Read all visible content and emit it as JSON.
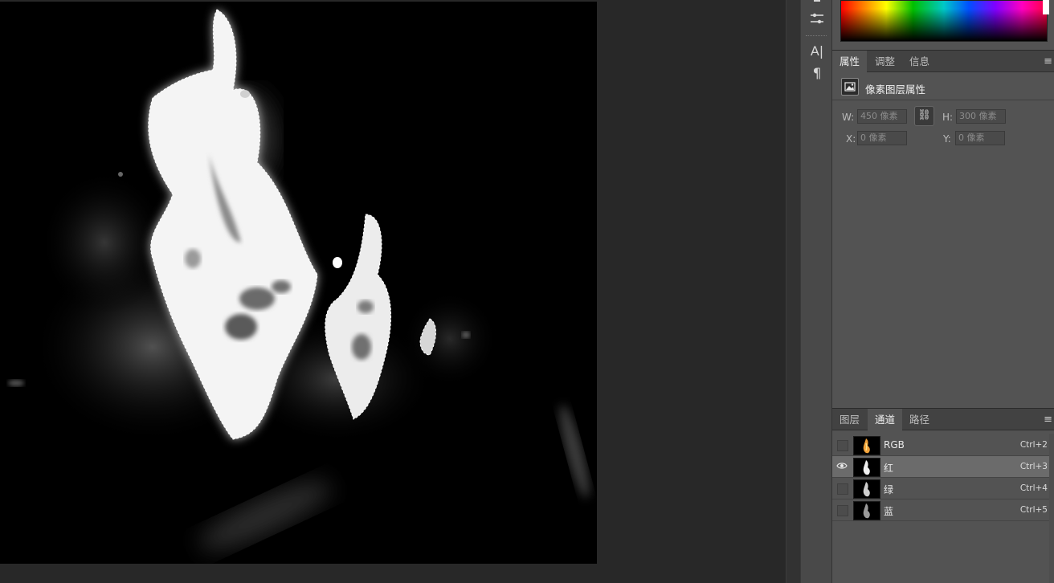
{
  "canvas": {
    "background_color": "#000000",
    "selection_outline": "marching-ants"
  },
  "toolbar_icons": [
    "brush-settings-icon",
    "adjustment-sliders-icon",
    "character-icon",
    "paragraph-icon"
  ],
  "toolbar_glyphs": {
    "character": "A|",
    "paragraph": "¶",
    "sliders": "⫶"
  },
  "properties_panel": {
    "tabs": [
      "属性",
      "调整",
      "信息"
    ],
    "active_tab": "属性",
    "header_title": "像素图层属性",
    "fields": {
      "w_label": "W:",
      "w_value": "450 像素",
      "h_label": "H:",
      "h_value": "300 像素",
      "x_label": "X:",
      "x_value": "0 像素",
      "y_label": "Y:",
      "y_value": "0 像素"
    },
    "link_glyph": "⛓"
  },
  "channels_panel": {
    "tabs": [
      "图层",
      "通道",
      "路径"
    ],
    "active_tab": "通道",
    "channels": [
      {
        "name": "RGB",
        "shortcut": "Ctrl+2",
        "visible": false,
        "selected": false
      },
      {
        "name": "红",
        "shortcut": "Ctrl+3",
        "visible": true,
        "selected": true
      },
      {
        "name": "绿",
        "shortcut": "Ctrl+4",
        "visible": false,
        "selected": false
      },
      {
        "name": "蓝",
        "shortcut": "Ctrl+5",
        "visible": false,
        "selected": false
      }
    ]
  },
  "panel_menu_glyph": "≡",
  "eye_glyph": "●"
}
